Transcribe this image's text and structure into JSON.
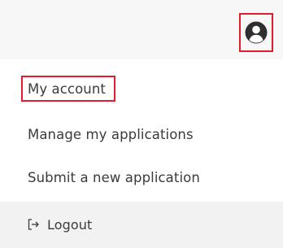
{
  "header": {
    "account_icon": "user-circle-icon",
    "accent_color": "#e21b2f"
  },
  "menu": {
    "my_account": "My account",
    "manage_applications": "Manage my applications",
    "submit_application": "Submit a new application",
    "logout": "Logout",
    "logout_icon": "logout-icon"
  }
}
